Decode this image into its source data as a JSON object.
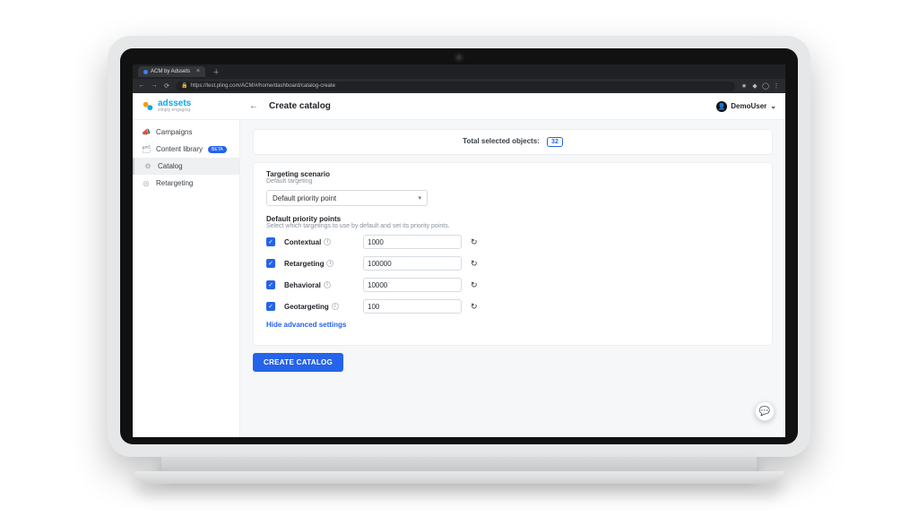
{
  "browser": {
    "tab_title": "ACM by Adssets",
    "url": "https://test.pling.com/ACM/#/home/dashboard/catalog-create"
  },
  "brand": {
    "name": "adssets",
    "tagline": "simply engaging"
  },
  "header": {
    "page_title": "Create catalog",
    "user_name": "DemoUser"
  },
  "sidebar": {
    "items": [
      {
        "label": "Campaigns"
      },
      {
        "label": "Content library",
        "badge": "BETA"
      },
      {
        "label": "Catalog",
        "active": true
      },
      {
        "label": "Retargeting"
      }
    ]
  },
  "summary": {
    "label": "Total selected objects:",
    "count": "32"
  },
  "scenario": {
    "title": "Targeting scenario",
    "subtitle": "Default targeting",
    "select_value": "Default priority point"
  },
  "priority": {
    "title": "Default priority points",
    "subtitle": "Select which targetings to use by default and set its priority points.",
    "rows": [
      {
        "label": "Contextual",
        "value": "1000"
      },
      {
        "label": "Retargeting",
        "value": "100000"
      },
      {
        "label": "Behavioral",
        "value": "10000"
      },
      {
        "label": "Geotargeting",
        "value": "100"
      }
    ]
  },
  "actions": {
    "hide_advanced": "Hide advanced settings",
    "create": "Create catalog"
  }
}
